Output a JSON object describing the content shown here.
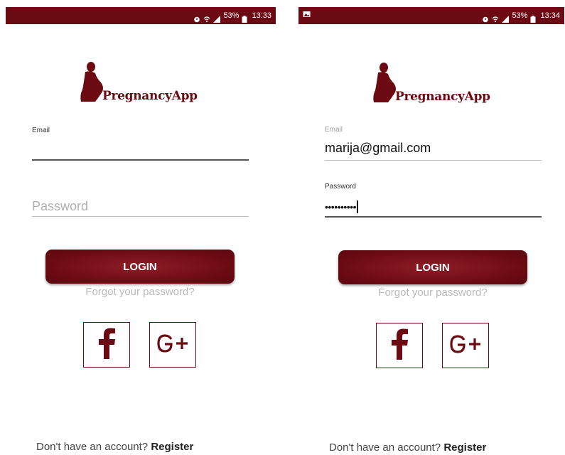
{
  "phone_left": {
    "status_bar": {
      "battery": "53%",
      "time": "13:33"
    },
    "app_name": "PregnancyApp",
    "email": {
      "label": "Email",
      "value": ""
    },
    "password": {
      "placeholder": "Password",
      "value": ""
    },
    "login_label": "LOGIN",
    "forgot_label": "Forgot your password?",
    "no_account_text": "Don't have an account?",
    "register_label": "Register"
  },
  "phone_right": {
    "status_bar": {
      "battery": "53%",
      "time": "13:34"
    },
    "app_name": "PregnancyApp",
    "email": {
      "label": "Email",
      "value": "marija@gmail.com"
    },
    "password": {
      "label": "Password",
      "masked_value": "••••••••••"
    },
    "login_label": "LOGIN",
    "forgot_label": "Forgot your password?",
    "no_account_text": "Don't have an account?",
    "register_label": "Register"
  },
  "social": {
    "facebook_glyph": "f",
    "google_glyph": "G+"
  },
  "colors": {
    "brand": "#6b0a12",
    "muted_text": "#b9b9b9"
  },
  "icons": [
    "alarm-icon",
    "wifi-icon",
    "signal-icon",
    "battery-icon",
    "image-notification-icon",
    "pregnant-woman-logo-icon",
    "facebook-icon",
    "google-plus-icon"
  ]
}
